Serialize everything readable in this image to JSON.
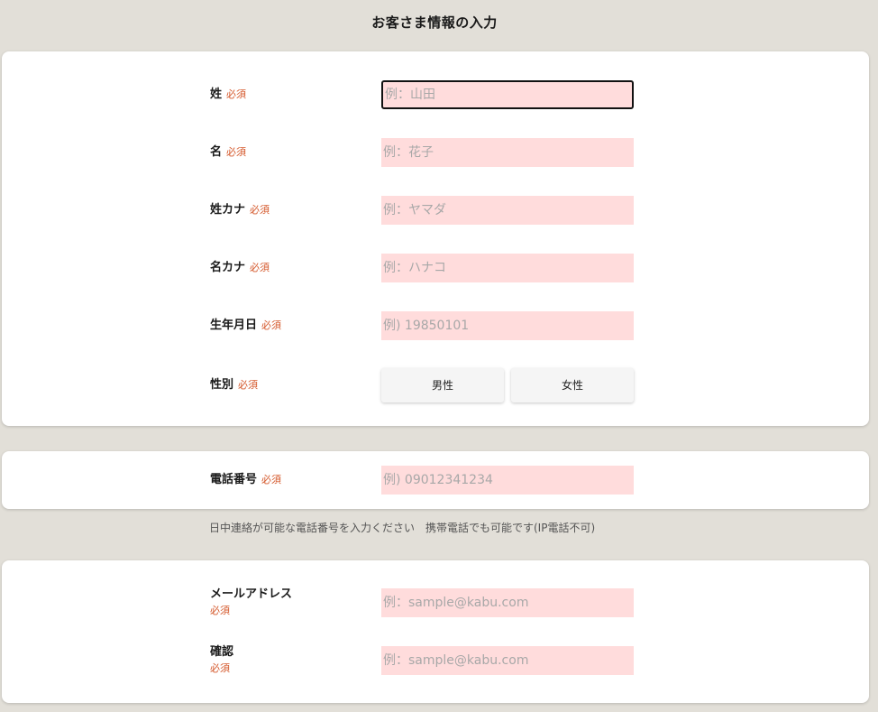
{
  "page": {
    "title": "お客さま情報の入力"
  },
  "required_label": "必須",
  "section1": {
    "last_name": {
      "label": "姓",
      "placeholder": "例：山田"
    },
    "first_name": {
      "label": "名",
      "placeholder": "例：花子"
    },
    "last_kana": {
      "label": "姓カナ",
      "placeholder": "例：ヤマダ"
    },
    "first_kana": {
      "label": "名カナ",
      "placeholder": "例：ハナコ"
    },
    "birthdate": {
      "label": "生年月日",
      "placeholder": "例) 19850101"
    },
    "gender": {
      "label": "性別",
      "options": [
        "男性",
        "女性"
      ]
    }
  },
  "section2": {
    "phone": {
      "label": "電話番号",
      "placeholder": "例) 09012341234"
    },
    "note": "日中連絡が可能な電話番号を入力ください　携帯電話でも可能です(IP電話不可)"
  },
  "section3": {
    "email": {
      "label": "メールアドレス",
      "placeholder": "例：sample@kabu.com"
    },
    "confirm": {
      "label": "確認",
      "placeholder": "例：sample@kabu.com"
    }
  },
  "colors": {
    "background": "#e2dfd8",
    "input_bg": "#ffdcdc",
    "required": "#d4572a"
  }
}
